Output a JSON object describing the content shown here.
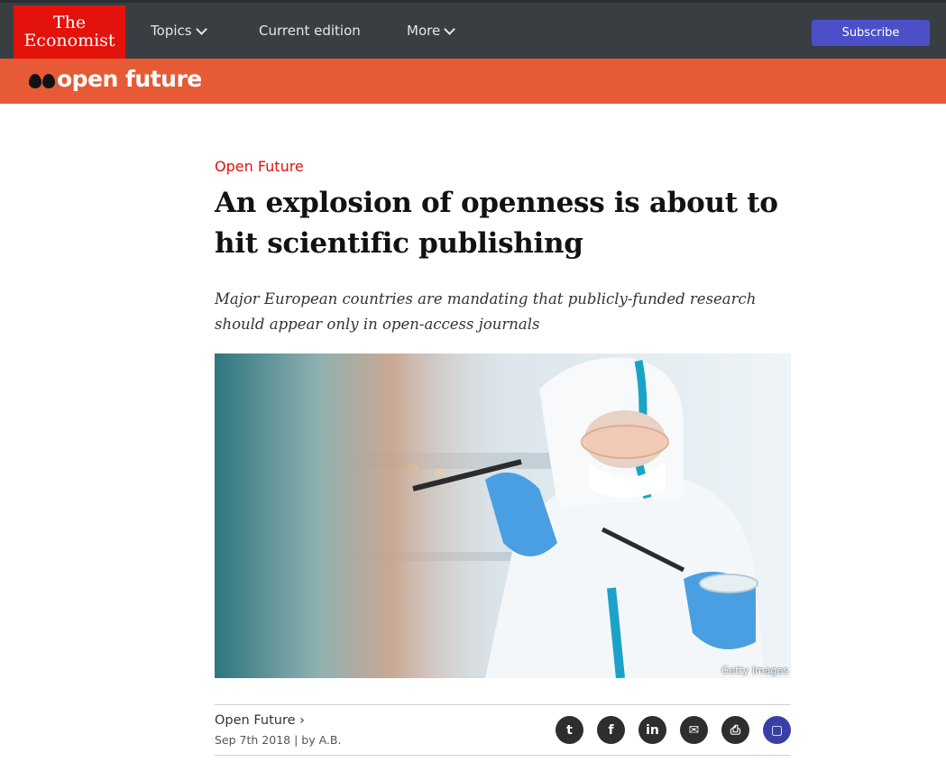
{
  "header": {
    "logo_line1": "The",
    "logo_line2": "Economist",
    "nav": [
      {
        "label": "Topics",
        "dropdown": true
      },
      {
        "label": "Current edition",
        "dropdown": false
      },
      {
        "label": "More",
        "dropdown": true
      }
    ],
    "subscribe_label": "Subscribe"
  },
  "banner": {
    "brand": "open future",
    "icon": "quote-marks-icon"
  },
  "article": {
    "section": "Open Future",
    "headline": "An explosion of openness is about to hit scientific publishing",
    "standfirst": "Major European countries are mandating that publicly-funded research should appear only in open-access journals",
    "image_credit": "Getty Images",
    "meta_section": "Open Future ›",
    "date": "Sep 7th 2018",
    "byline": "by A.B."
  },
  "share": [
    {
      "icon": "twitter-icon",
      "glyph": "t"
    },
    {
      "icon": "facebook-icon",
      "glyph": "f"
    },
    {
      "icon": "linkedin-icon",
      "glyph": "in"
    },
    {
      "icon": "email-icon",
      "glyph": "✉"
    },
    {
      "icon": "print-icon",
      "glyph": "⎙"
    },
    {
      "icon": "comment-icon",
      "glyph": "▢"
    }
  ],
  "colors": {
    "nav_bg": "#383e42",
    "brand_red": "#e3120b",
    "banner_orange": "#e65a35",
    "subscribe_blue": "#4b4fc8"
  }
}
